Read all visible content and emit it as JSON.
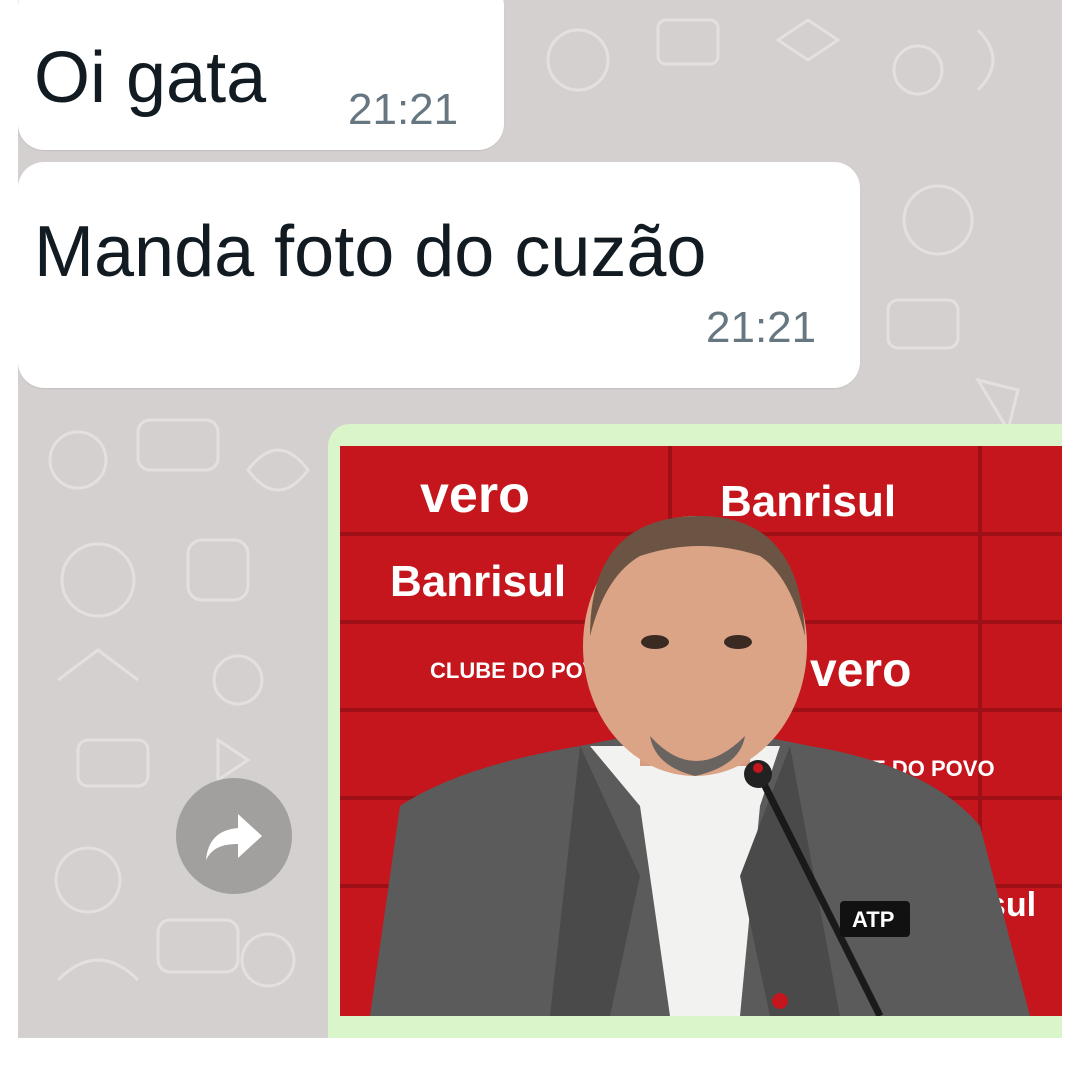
{
  "messages": [
    {
      "text": "Oi gata",
      "time": "21:21"
    },
    {
      "text": "Manda foto do cuzão",
      "time": "21:21"
    }
  ],
  "photo": {
    "sponsors": [
      "vero",
      "Banrisul",
      "CLUBE DO POVO"
    ],
    "press_tag": "ATP"
  },
  "colors": {
    "chat_background": "#d4d0cf",
    "incoming_bubble": "#ffffff",
    "outgoing_bubble": "#d9f5c9",
    "backdrop_red": "#c4161c"
  },
  "icons": {
    "forward": "forward-arrow-icon"
  }
}
